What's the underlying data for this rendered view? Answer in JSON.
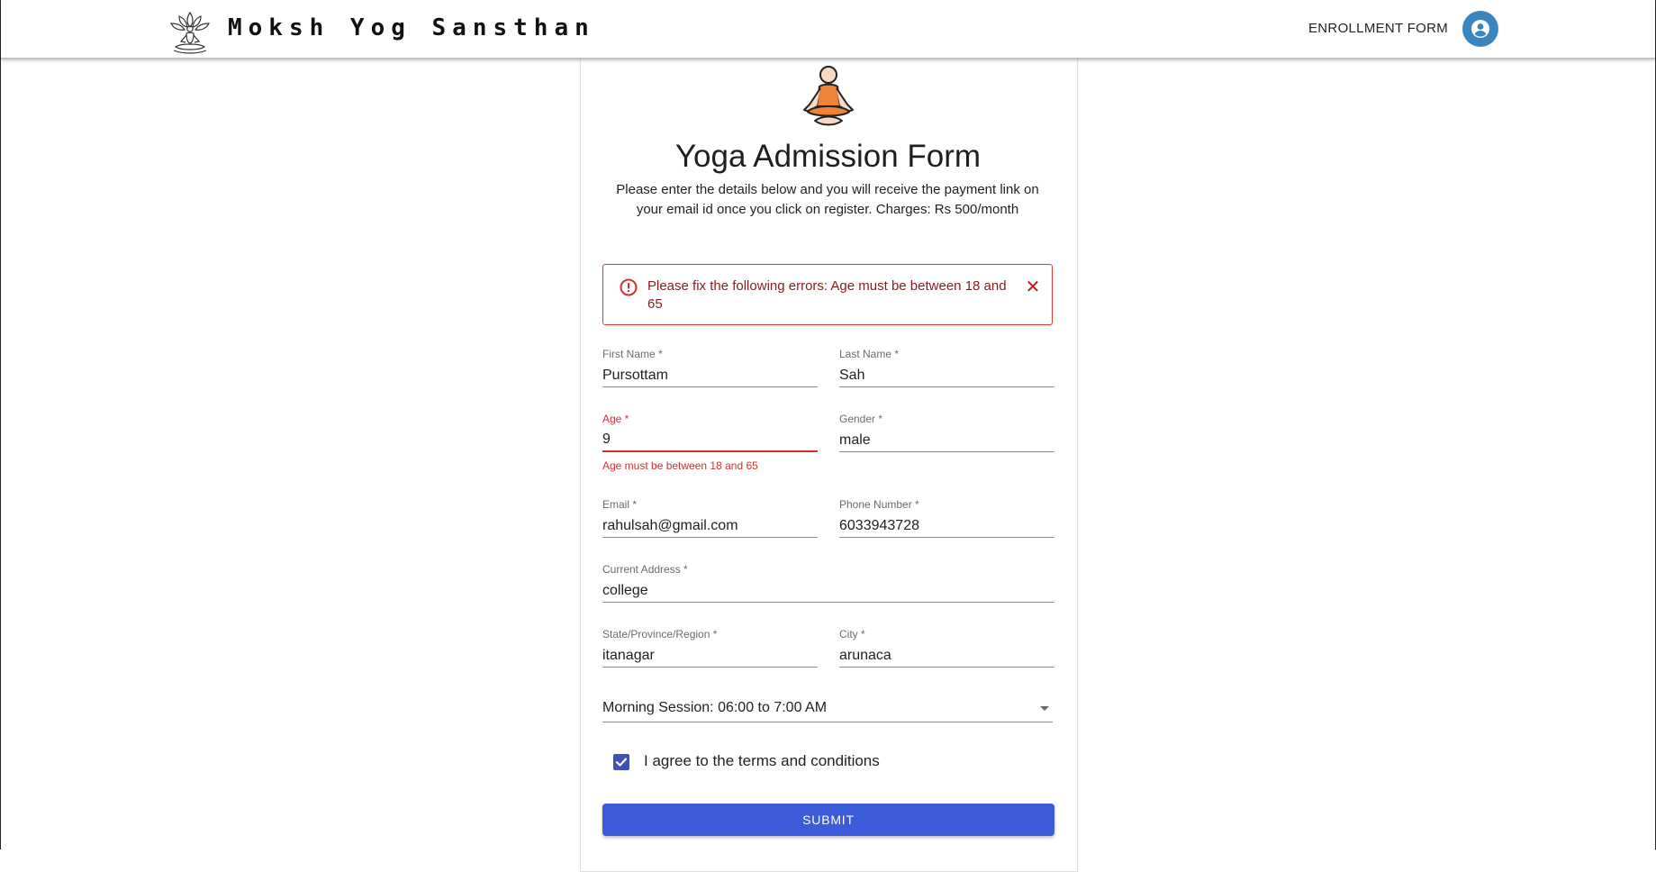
{
  "header": {
    "brand": "Moksh Yog Sansthan",
    "nav_link": "ENROLLMENT FORM"
  },
  "form": {
    "title": "Yoga Admission Form",
    "subtitle": "Please enter the details below and you will receive the payment link on your email id once you click on register. Charges: Rs 500/month",
    "alert": {
      "message": "Please fix the following errors: Age must be between 18 and 65",
      "close_symbol": "✕"
    },
    "fields": {
      "first_name": {
        "label": "First Name *",
        "value": "Pursottam"
      },
      "last_name": {
        "label": "Last Name *",
        "value": "Sah"
      },
      "age": {
        "label": "Age *",
        "value": "9",
        "helper": "Age must be between 18 and 65"
      },
      "gender": {
        "label": "Gender *",
        "value": "male"
      },
      "email": {
        "label": "Email *",
        "value": "rahulsah@gmail.com"
      },
      "phone": {
        "label": "Phone Number *",
        "value": "6033943728"
      },
      "address": {
        "label": "Current Address *",
        "value": "college"
      },
      "state": {
        "label": "State/Province/Region *",
        "value": "itanagar"
      },
      "city": {
        "label": "City *",
        "value": "arunaca"
      }
    },
    "session": {
      "selected": "Morning Session: 06:00 to 7:00 AM"
    },
    "terms": {
      "label": "I agree to the terms and conditions",
      "checked": true
    },
    "submit_label": "SUBMIT"
  },
  "colors": {
    "primary": "#3b5bdb",
    "error": "#d32f2f",
    "avatar": "#3a87bf",
    "yogi_orange": "#f0833a"
  }
}
